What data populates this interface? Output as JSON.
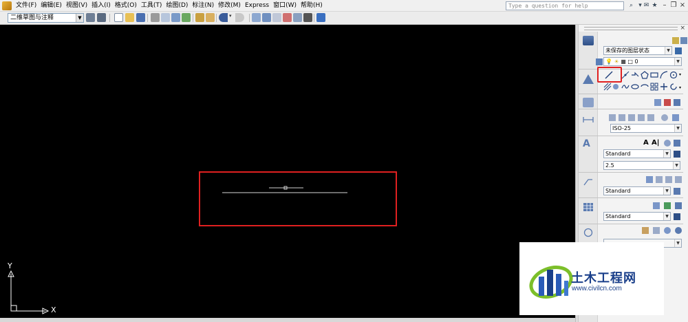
{
  "menubar": {
    "items": [
      "文件(F)",
      "编辑(E)",
      "视图(V)",
      "插入(I)",
      "格式(O)",
      "工具(T)",
      "绘图(D)",
      "标注(N)",
      "修改(M)",
      "Express",
      "窗口(W)",
      "帮助(H)"
    ],
    "help_search_placeholder": "Type a question for help"
  },
  "toolbar": {
    "workspace_value": "二维草图与注释"
  },
  "canvas": {
    "ucs_y_label": "Y",
    "ucs_x_label": "X",
    "highlight_color": "#e02020"
  },
  "panel": {
    "layer_state_value": "未保存的图层状态",
    "layer_value": "0",
    "dim_style_value": "ISO-25",
    "text_style_value": "Standard",
    "text_height_value": "2.5",
    "mleader_style_value": "Standard",
    "table_style_value": "Standard"
  },
  "watermark": {
    "title": "土木工程网",
    "url": "www.civilcn.com"
  },
  "colors": {
    "canvas_bg": "#000000",
    "highlight": "#e02020",
    "brand_blue": "#1a3f8a"
  }
}
